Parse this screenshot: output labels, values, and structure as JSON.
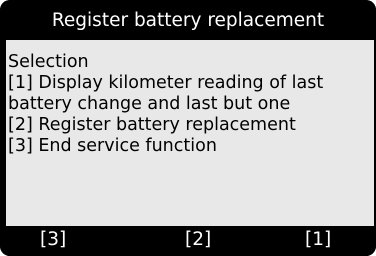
{
  "screen": {
    "title": "Register battery replacement",
    "lines": [
      "Selection",
      "[1] Display kilometer reading of last",
      "battery change and last but one",
      "[2] Register battery replacement",
      "[3] End service function"
    ]
  },
  "footer": {
    "keys": [
      "[3]",
      "[2]",
      "[1]"
    ]
  },
  "colors": {
    "background": "#000000",
    "content_background": "#e8e8e8",
    "title_text": "#ffffff",
    "content_text": "#000000"
  }
}
